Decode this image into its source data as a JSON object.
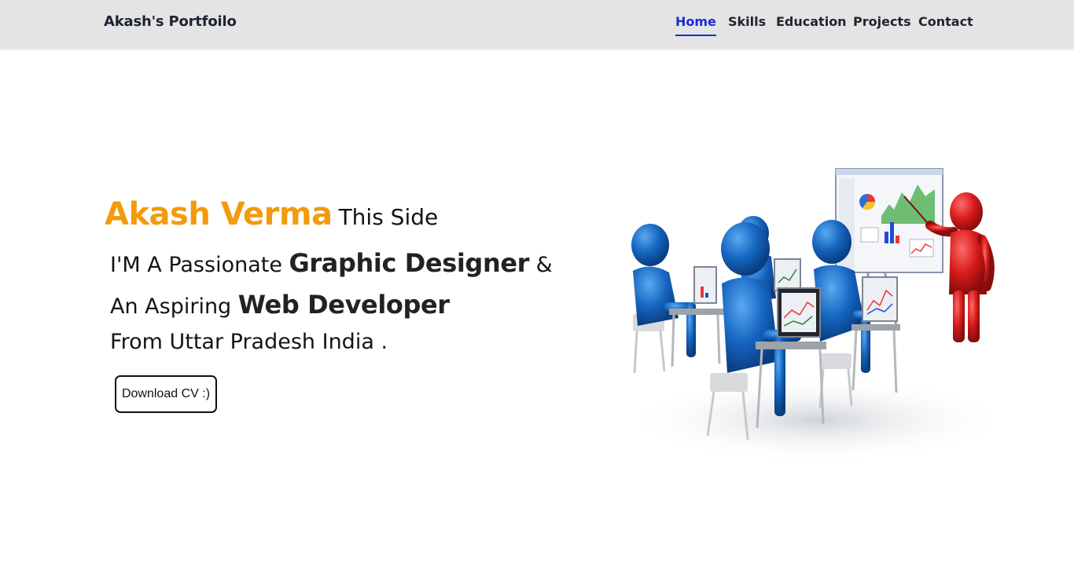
{
  "nav": {
    "brand": "Akash's Portfoilo",
    "links": [
      {
        "label": "Home",
        "active": true
      },
      {
        "label": "Skills",
        "active": false
      },
      {
        "label": "Education",
        "active": false
      },
      {
        "label": "Projects",
        "active": false
      },
      {
        "label": "Contact",
        "active": false
      }
    ]
  },
  "hero": {
    "name": "Akash Verma",
    "name_suffix": "This Side",
    "line2_prefix": "I'M A Passionate",
    "line2_strong": "Graphic Designer",
    "line2_suffix": "&",
    "line3_prefix": "An Aspiring",
    "line3_strong": "Web Developer",
    "line4": "From Uttar Pradesh India .",
    "cv_button": "Download CV :)"
  },
  "colors": {
    "accent": "#f39a0d",
    "nav_active": "#1a2bd8",
    "nav_background": "#e4e4e4",
    "figure_blue": "#1565c0",
    "figure_red": "#d81b1b"
  }
}
